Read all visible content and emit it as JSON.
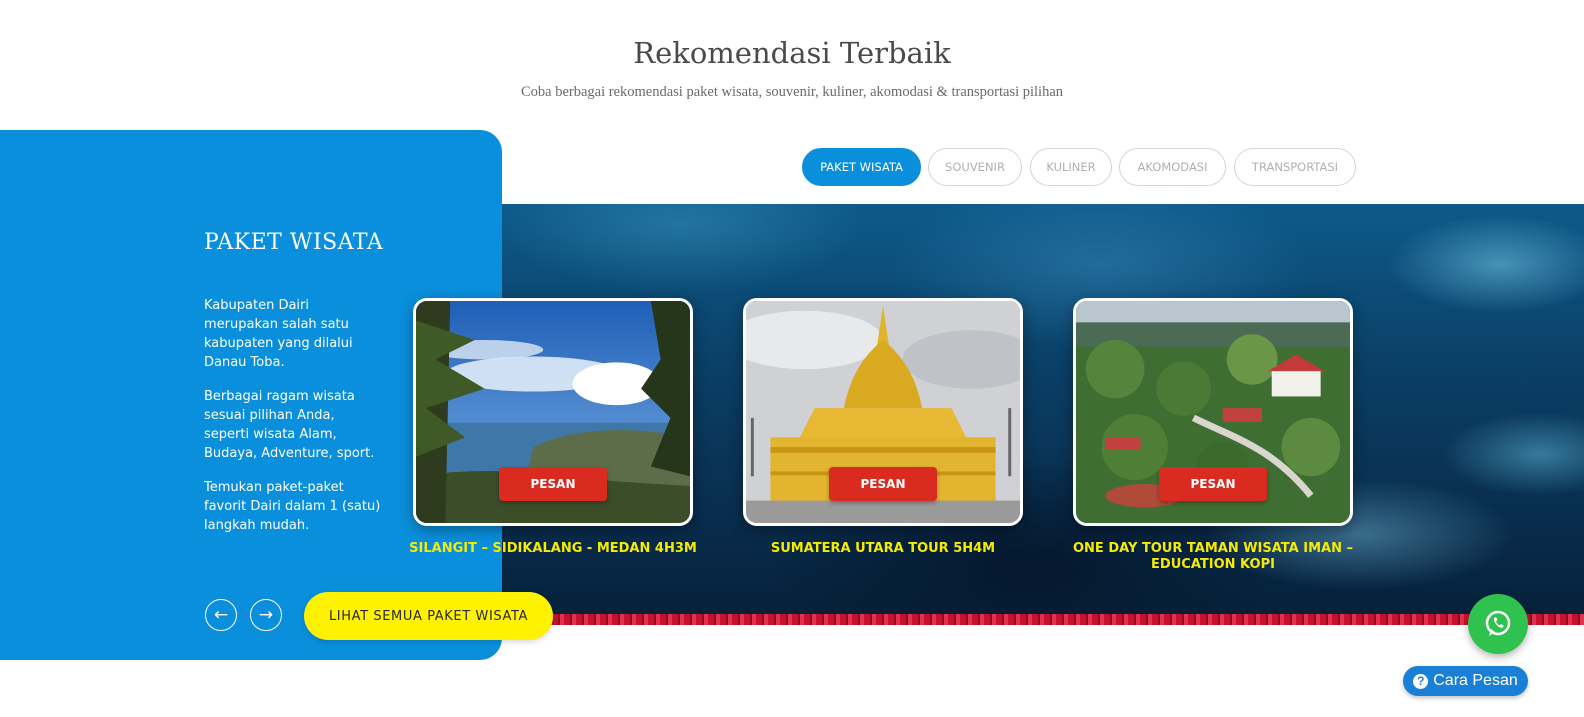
{
  "header": {
    "title": "Rekomendasi Terbaik",
    "subtitle": "Coba berbagai rekomendasi paket wisata, souvenir, kuliner, akomodasi & transportasi pilihan"
  },
  "tabs": [
    {
      "label": "PAKET WISATA",
      "active": true
    },
    {
      "label": "SOUVENIR",
      "active": false
    },
    {
      "label": "KULINER",
      "active": false
    },
    {
      "label": "AKOMODASI",
      "active": false
    },
    {
      "label": "TRANSPORTASI",
      "active": false
    }
  ],
  "panel": {
    "title": "PAKET WISATA",
    "paragraphs": [
      "Kabupaten Dairi merupakan salah satu kabupaten yang dilalui Danau Toba.",
      "Berbagai ragam wisata sesuai pilihan Anda, seperti wisata Alam, Budaya, Adventure, sport.",
      "Temukan paket-paket favorit Dairi dalam 1 (satu) langkah mudah."
    ],
    "prev_icon": "arrow-left-icon",
    "next_icon": "arrow-right-icon",
    "see_all_label": "LIHAT SEMUA PAKET WISATA"
  },
  "cards": [
    {
      "title": "SILANGIT – SIDIKALANG - MEDAN 4H3M",
      "button": "PESAN"
    },
    {
      "title": "SUMATERA UTARA TOUR 5H4M",
      "button": "PESAN"
    },
    {
      "title": "ONE DAY TOUR TAMAN WISATA IMAN – EDUCATION KOPI",
      "button": "PESAN"
    }
  ],
  "floating": {
    "whatsapp_icon": "whatsapp-icon",
    "help_icon": "question-circle-icon",
    "cara_pesan_label": "Cara Pesan"
  },
  "colors": {
    "brand_blue": "#0a8fdc",
    "accent_yellow": "#fff200",
    "card_title_yellow": "#f5ec00",
    "button_red": "#d92b20",
    "whatsapp_green": "#2fc24f"
  }
}
